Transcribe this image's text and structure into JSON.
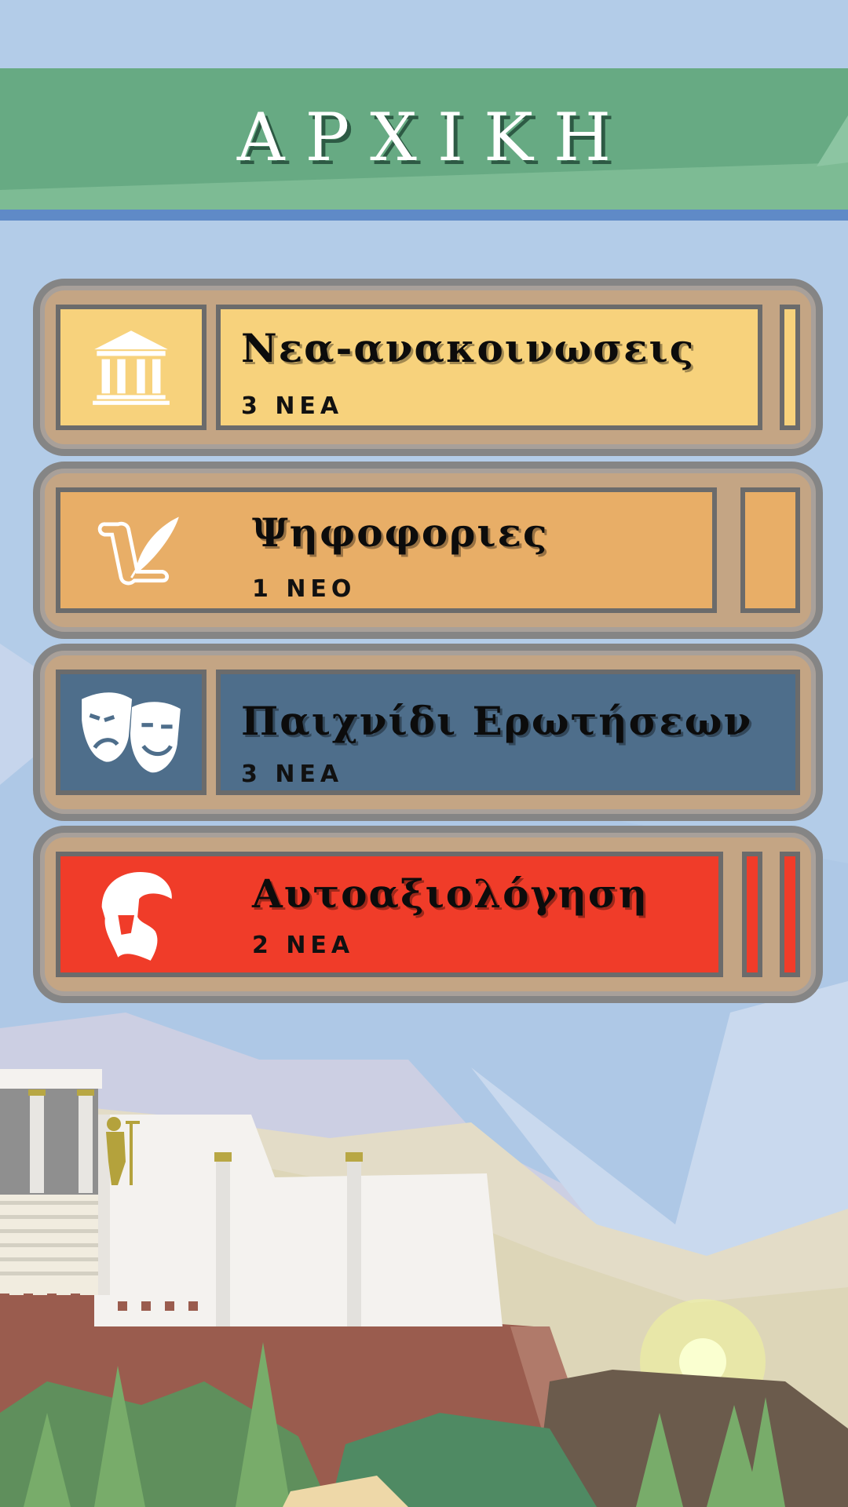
{
  "header": {
    "title": "ΑΡΧΙΚΗ"
  },
  "menu": [
    {
      "label": "Νεα-ανακοινωσεις",
      "count": "3 ΝΕΑ",
      "icon": "temple-icon",
      "color": "#f7d27c"
    },
    {
      "label": "Ψηφοφοριες",
      "count": "1 ΝΕΟ",
      "icon": "scroll-quill-icon",
      "color": "#e8ae67"
    },
    {
      "label": "Παιχνίδι Ερωτήσεων",
      "count": "3 ΝΕΑ",
      "icon": "theater-masks-icon",
      "color": "#4e6e8b"
    },
    {
      "label": "Αυτοαξιολόγηση",
      "count": "2 ΝΕΑ",
      "icon": "spartan-helmet-icon",
      "color": "#f03c29"
    }
  ],
  "colors": {
    "sky": "#aec8e6",
    "header_green": "#67aa83",
    "header_stripe": "#5f8ac7",
    "card_frame": "#c4a584"
  }
}
